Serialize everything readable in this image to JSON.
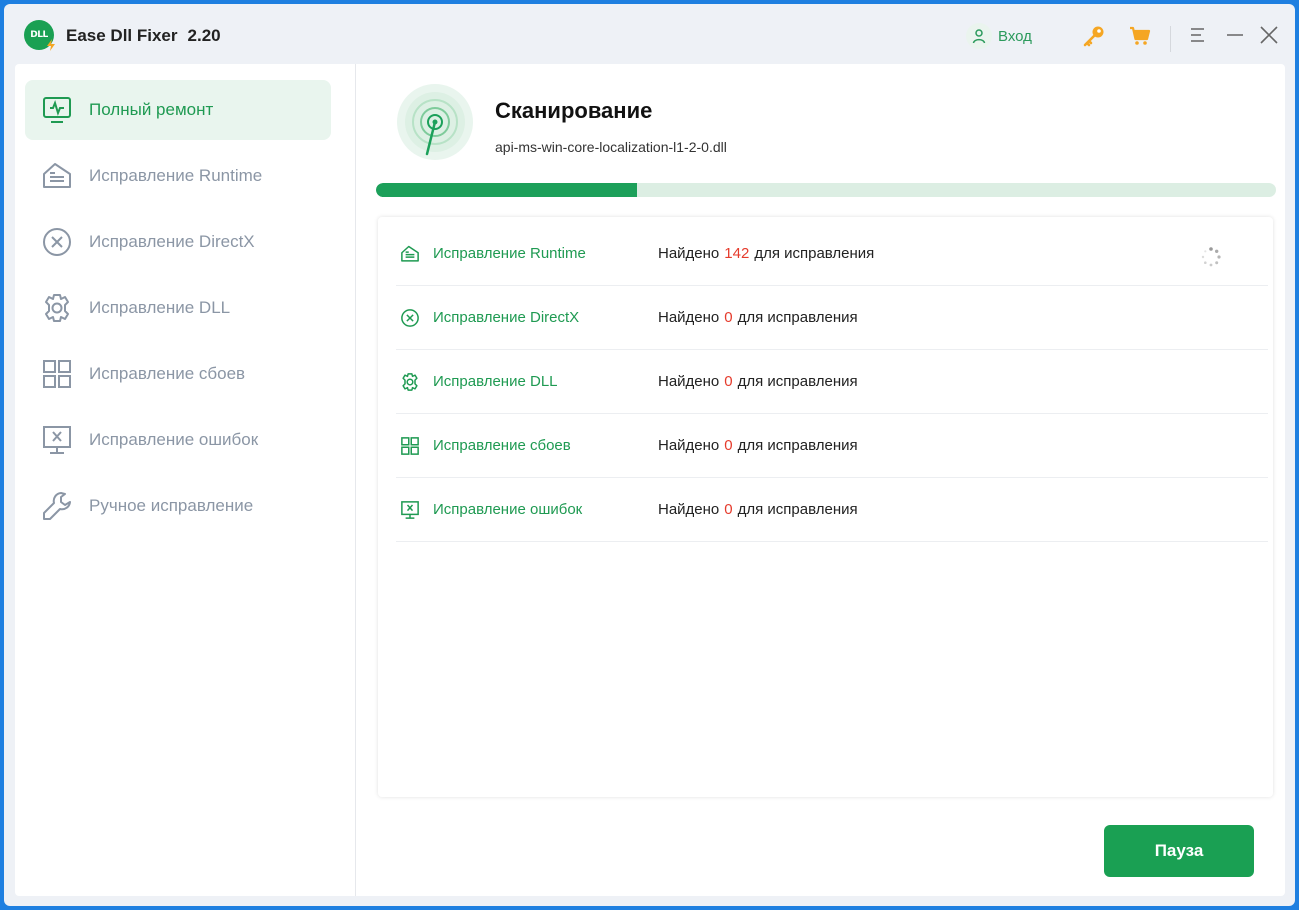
{
  "app": {
    "logo_text": "DLL",
    "title": "Ease Dll Fixer",
    "version": "2.20"
  },
  "header": {
    "login_label": "Вход",
    "icons": [
      "user-icon",
      "key-icon",
      "cart-icon",
      "menu-icon",
      "minimize-icon",
      "close-icon"
    ]
  },
  "sidebar": {
    "items": [
      {
        "label": "Полный ремонт",
        "icon": "monitor-pulse-icon",
        "active": true
      },
      {
        "label": "Исправление Runtime",
        "icon": "runtime-icon",
        "active": false
      },
      {
        "label": "Исправление DirectX",
        "icon": "circle-x-icon",
        "active": false
      },
      {
        "label": "Исправление DLL",
        "icon": "gear-icon",
        "active": false
      },
      {
        "label": "Исправление сбоев",
        "icon": "grid-icon",
        "active": false
      },
      {
        "label": "Исправление ошибок",
        "icon": "monitor-x-icon",
        "active": false
      },
      {
        "label": "Ручное исправление",
        "icon": "wrench-icon",
        "active": false
      }
    ]
  },
  "scan": {
    "title": "Сканирование",
    "current_file": "api-ms-win-core-localization-l1-2-0.dll",
    "progress_percent": 29
  },
  "results": {
    "found_prefix": "Найдено",
    "found_suffix": "для исправления",
    "rows": [
      {
        "label": "Исправление Runtime",
        "count": "142",
        "icon": "runtime-icon",
        "in_progress": true
      },
      {
        "label": "Исправление DirectX",
        "count": "0",
        "icon": "circle-x-icon",
        "in_progress": false
      },
      {
        "label": "Исправление DLL",
        "count": "0",
        "icon": "gear-icon",
        "in_progress": false
      },
      {
        "label": "Исправление сбоев",
        "count": "0",
        "icon": "grid-icon",
        "in_progress": false
      },
      {
        "label": "Исправление ошибок",
        "count": "0",
        "icon": "monitor-x-icon",
        "in_progress": false
      }
    ]
  },
  "actions": {
    "pause_label": "Пауза"
  },
  "colors": {
    "accent": "#1aa053",
    "accent_text": "#1f9a52",
    "count_red": "#e53b2c",
    "key_orange": "#f5a623",
    "sidebar_inactive": "#8b96a5",
    "window_frame": "#1e7fe0"
  }
}
